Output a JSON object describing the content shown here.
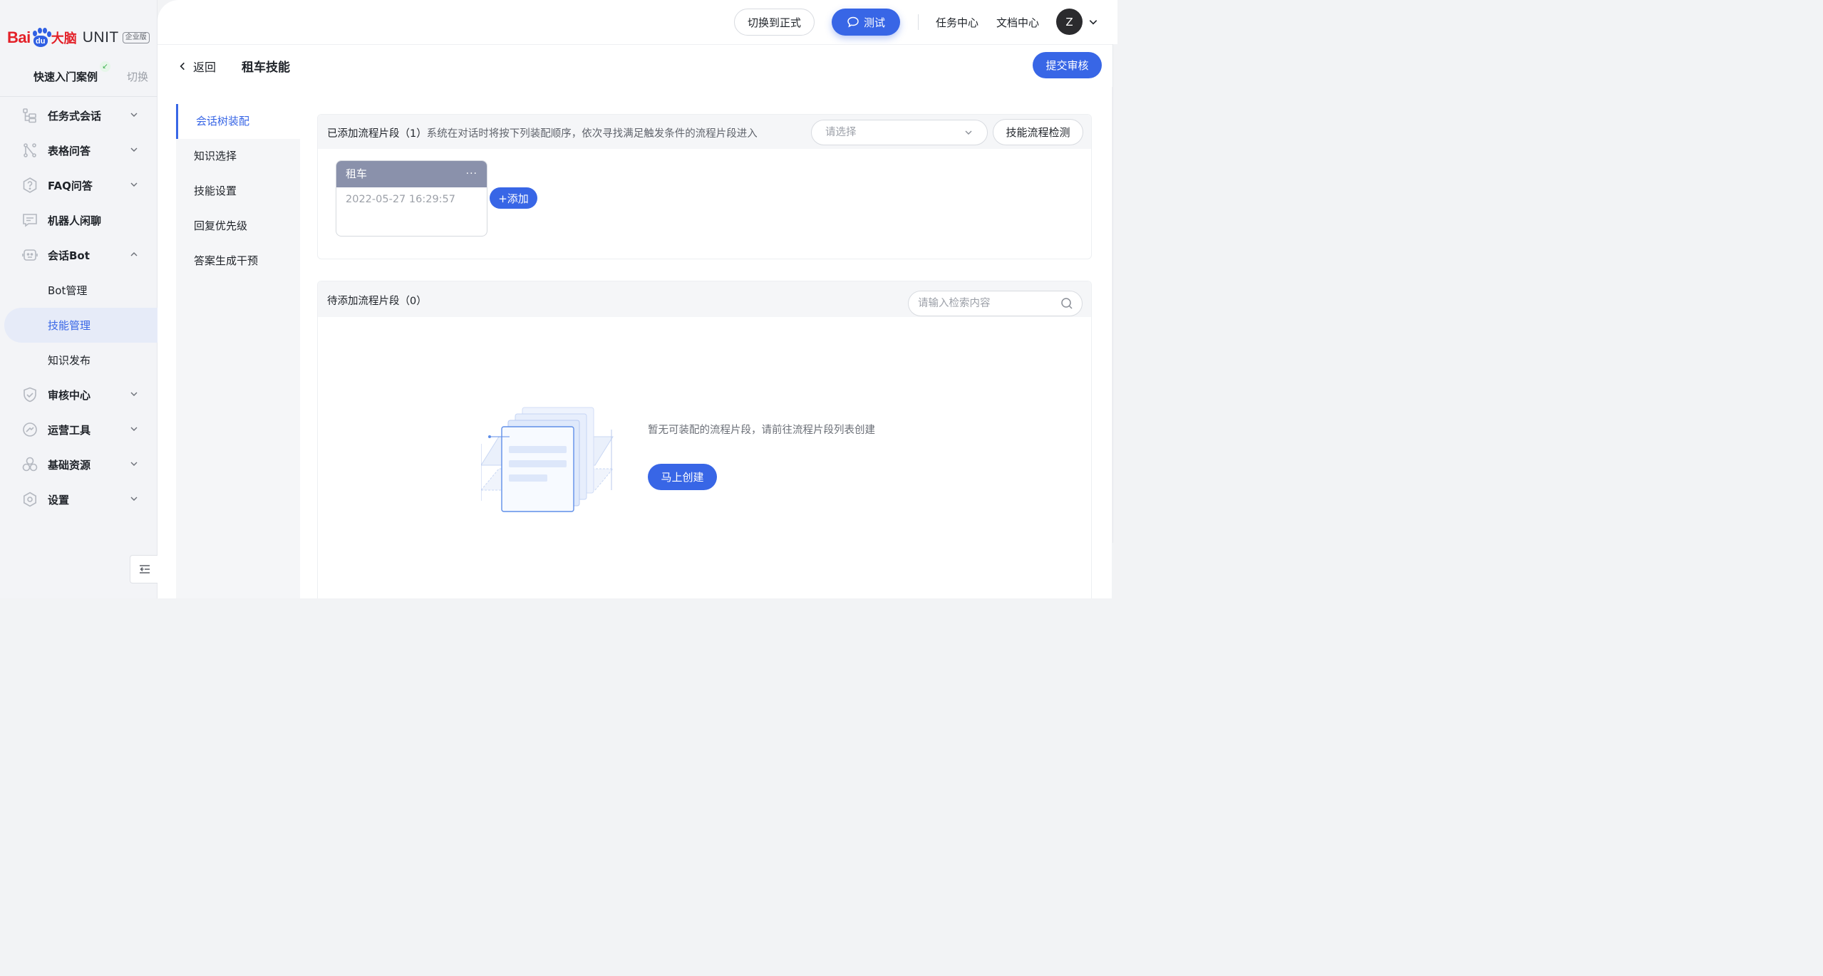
{
  "brand": {
    "logo_bai": "Bai",
    "logo_du": "du",
    "logo_danao": "大脑",
    "logo_unit": "UNIT",
    "edition": "企业版"
  },
  "sidebar": {
    "quick_case": "快速入门案例",
    "switch_label": "切换",
    "items": [
      {
        "label": "任务式会话",
        "icon": "task-dialog-icon",
        "expand": "chevron-down"
      },
      {
        "label": "表格问答",
        "icon": "table-qa-icon",
        "expand": "chevron-down"
      },
      {
        "label": "FAQ问答",
        "icon": "faq-icon",
        "expand": "chevron-down"
      },
      {
        "label": "机器人闲聊",
        "icon": "chat-icon",
        "expand": ""
      },
      {
        "label": "会话Bot",
        "icon": "bot-icon",
        "expand": "chevron-up"
      },
      {
        "label": "Bot管理",
        "sub": true
      },
      {
        "label": "技能管理",
        "sub": true,
        "active": true
      },
      {
        "label": "知识发布",
        "sub": true
      },
      {
        "label": "审核中心",
        "icon": "shield-icon",
        "expand": "chevron-down"
      },
      {
        "label": "运营工具",
        "icon": "ops-tool-icon",
        "expand": "chevron-down"
      },
      {
        "label": "基础资源",
        "icon": "resource-icon",
        "expand": "chevron-down"
      },
      {
        "label": "设置",
        "icon": "settings-icon",
        "expand": "chevron-down"
      }
    ]
  },
  "topbar": {
    "switch_formal": "切换到正式",
    "test": "测试",
    "task_center": "任务中心",
    "doc_center": "文档中心",
    "avatar_letter": "Z"
  },
  "header": {
    "back": "返回",
    "title": "租车技能",
    "submit": "提交审核"
  },
  "tabs": [
    {
      "label": "会话树装配",
      "active": true
    },
    {
      "label": "知识选择"
    },
    {
      "label": "技能设置"
    },
    {
      "label": "回复优先级"
    },
    {
      "label": "答案生成干预"
    }
  ],
  "added_panel": {
    "title": "已添加流程片段（1）",
    "description": "系统在对话时将按下列装配顺序，依次寻找满足触发条件的流程片段进入",
    "select_placeholder": "请选择",
    "check_button": "技能流程检测",
    "card": {
      "name": "租车",
      "more": "···",
      "time": "2022-05-27 16:29:57"
    },
    "add_button": "+添加"
  },
  "pending_panel": {
    "title": "待添加流程片段（0）",
    "search_placeholder": "请输入检索内容",
    "empty_text": "暂无可装配的流程片段，请前往流程片段列表创建",
    "create_button": "马上创建"
  },
  "colors": {
    "primary": "#3866e6",
    "card_header": "#8a91ab",
    "brand_red": "#e32028",
    "brand_blue": "#2f5fe3"
  }
}
